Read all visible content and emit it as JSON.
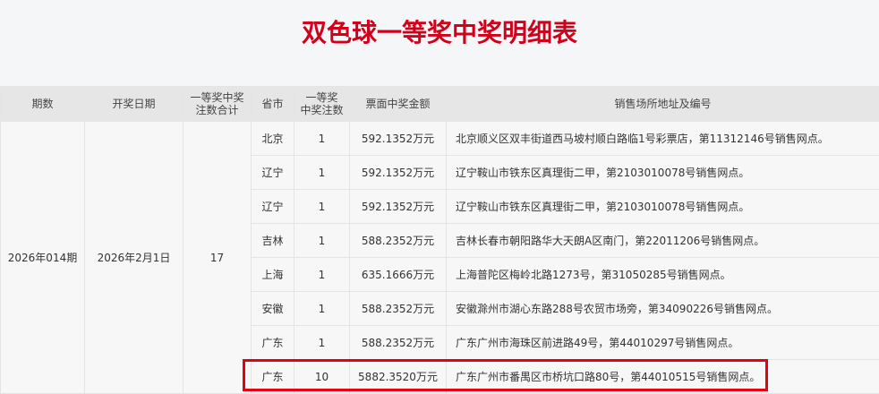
{
  "title": "双色球一等奖中奖明细表",
  "headers": {
    "period": "期数",
    "date": "开奖日期",
    "total_line1": "一等奖中奖",
    "total_line2": "注数合计",
    "province": "省市",
    "count_line1": "一等奖",
    "count_line2": "中奖注数",
    "amount": "票面中奖金额",
    "address": "销售场所地址及编号"
  },
  "summary": {
    "period": "2026年014期",
    "date": "2026年2月1日",
    "total": "17"
  },
  "rows": [
    {
      "province": "北京",
      "count": "1",
      "amount": "592.1352万元",
      "address": "北京顺义区双丰街道西马坡村顺白路临1号彩票店，第11312146号销售网点。"
    },
    {
      "province": "辽宁",
      "count": "1",
      "amount": "592.1352万元",
      "address": "辽宁鞍山市铁东区真理街二甲，第2103010078号销售网点。"
    },
    {
      "province": "辽宁",
      "count": "1",
      "amount": "592.1352万元",
      "address": "辽宁鞍山市铁东区真理街二甲，第2103010078号销售网点。"
    },
    {
      "province": "吉林",
      "count": "1",
      "amount": "588.2352万元",
      "address": "吉林长春市朝阳路华大天朗A区南门，第22011206号销售网点。"
    },
    {
      "province": "上海",
      "count": "1",
      "amount": "635.1666万元",
      "address": "上海普陀区梅岭北路1273号，第31050285号销售网点。"
    },
    {
      "province": "安徽",
      "count": "1",
      "amount": "588.2352万元",
      "address": "安徽滁州市湖心东路288号农贸市场旁，第34090226号销售网点。"
    },
    {
      "province": "广东",
      "count": "1",
      "amount": "588.2352万元",
      "address": "广东广州市海珠区前进路49号，第44010297号销售网点。"
    },
    {
      "province": "广东",
      "count": "10",
      "amount": "5882.3520万元",
      "address": "广东广州市番禺区市桥坑口路80号，第44010515号销售网点。"
    }
  ],
  "colors": {
    "title": "#d0021b",
    "highlight": "#e60012"
  }
}
